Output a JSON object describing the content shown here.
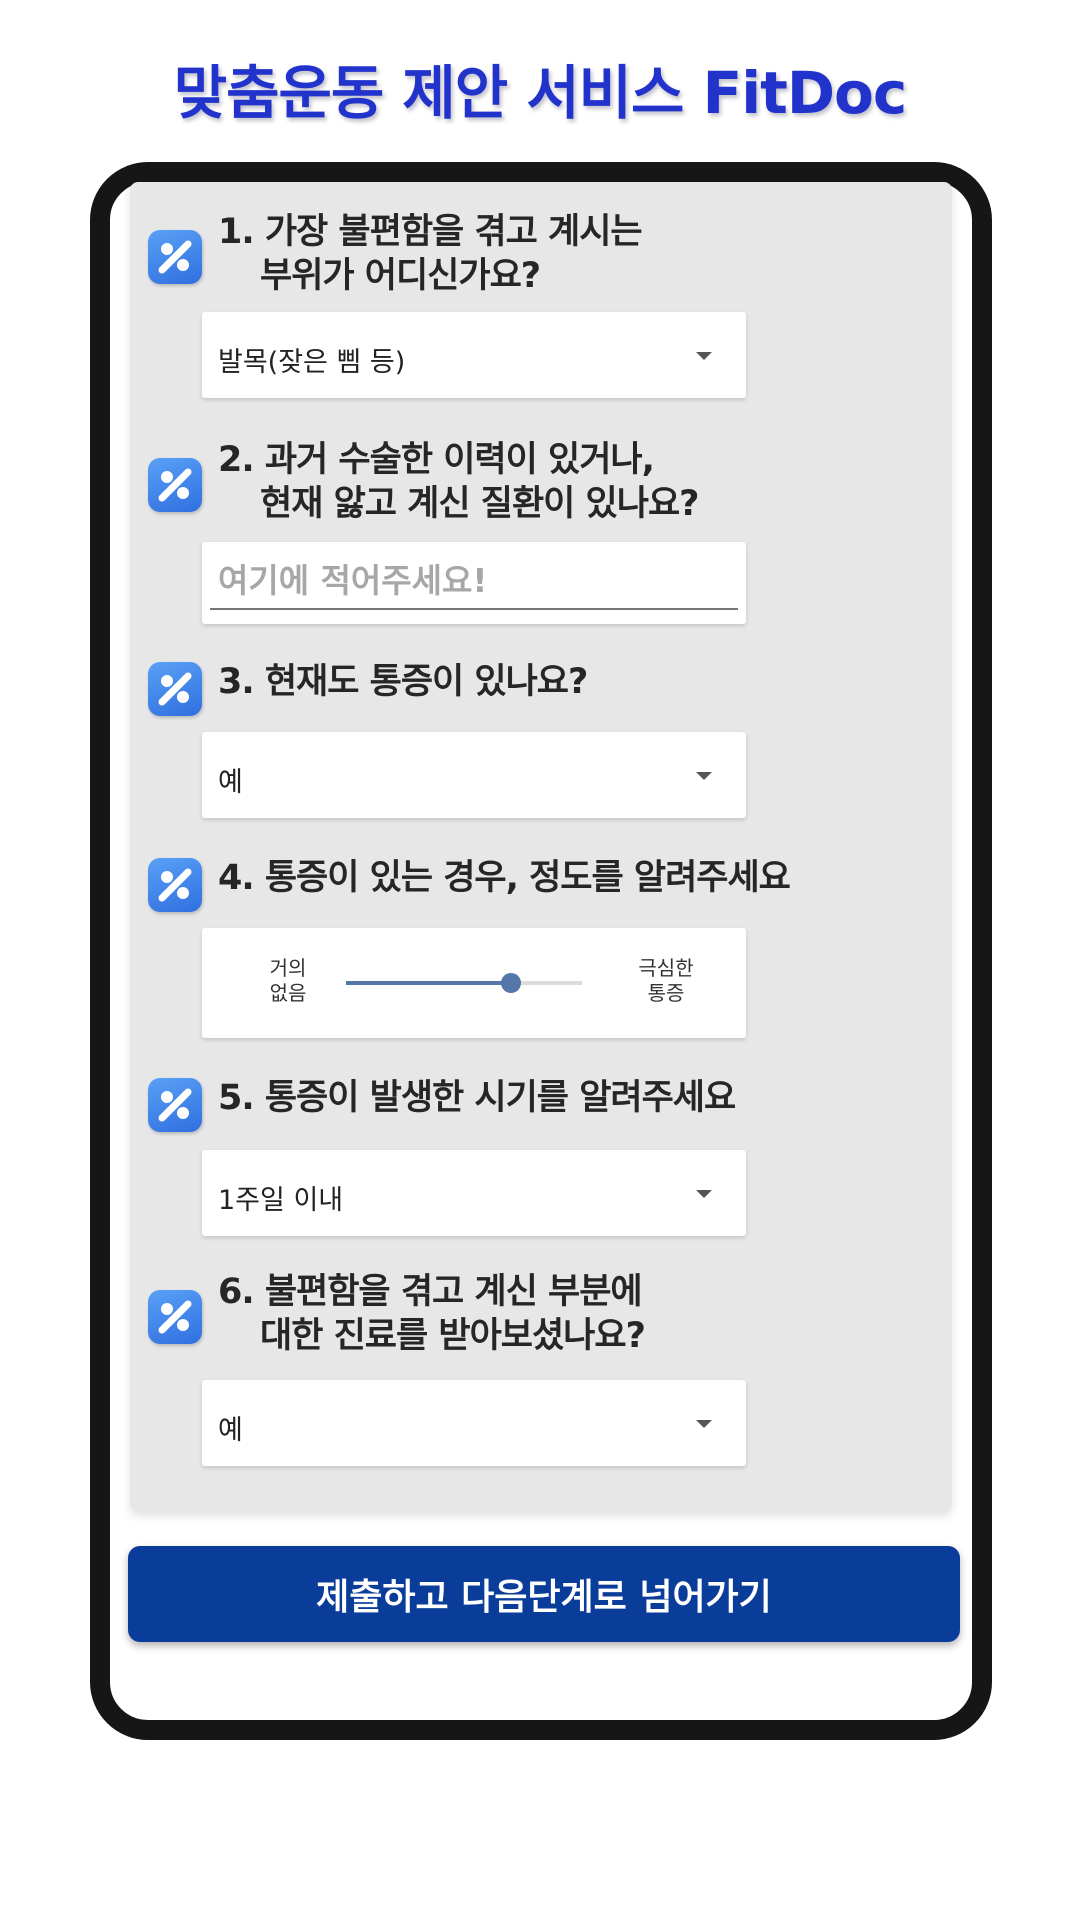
{
  "header": {
    "title": "맞춤운동 제안 서비스 FitDoc"
  },
  "questions": [
    {
      "line1": "1. 가장 불편함을 겪고 계시는",
      "line2": "부위가 어디신가요?",
      "icon": "percent-icon"
    },
    {
      "line1": "2. 과거 수술한 이력이 있거나,",
      "line2": "현재 앓고 계신 질환이 있나요?",
      "icon": "percent-icon"
    },
    {
      "line1": "3. 현재도 통증이 있나요?",
      "line2": "",
      "icon": "percent-icon"
    },
    {
      "line1": "4. 통증이 있는 경우, 정도를 알려주세요",
      "line2": "",
      "icon": "percent-icon"
    },
    {
      "line1": "5. 통증이 발생한 시기를 알려주세요",
      "line2": "",
      "icon": "percent-icon"
    },
    {
      "line1": "6. 불편함을 겪고 계신 부분에",
      "line2": "대한 진료를 받아보셨나요?",
      "icon": "percent-icon"
    }
  ],
  "answers": {
    "q1_select": "발목(잦은 삠 등)",
    "q2_placeholder": "여기에 적어주세요!",
    "q2_value": "",
    "q3_select": "예",
    "q4_slider": {
      "min_label_1": "거의",
      "min_label_2": "없음",
      "max_label_1": "극심한",
      "max_label_2": "통증",
      "value_fraction": 0.7
    },
    "q5_select": "1주일 이내",
    "q6_select": "예"
  },
  "submit": {
    "label": "제출하고 다음단계로 넘어가기"
  },
  "colors": {
    "title": "#2233cc",
    "button": "#0a3d99",
    "icon": "#3b7ee8",
    "slider": "#5576a8",
    "card": "#e7e7e7",
    "frame": "#161616"
  }
}
